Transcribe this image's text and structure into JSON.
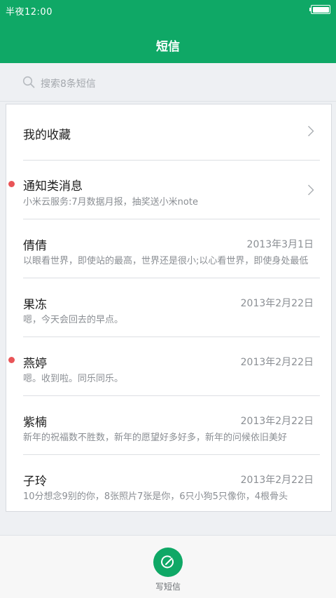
{
  "status": {
    "time": "半夜12:00"
  },
  "header": {
    "title": "短信"
  },
  "search": {
    "placeholder": "搜索8条短信"
  },
  "favorites": {
    "label": "我的收藏"
  },
  "notifications": {
    "title": "通知类消息",
    "preview": "小米云服务:7月数据月报，抽奖送小米note",
    "unread": true
  },
  "conversations": [
    {
      "name": "倩倩",
      "date": "2013年3月1日",
      "preview": "以眼看世界，即使站的最高，世界还是很小;以心看世界，即使身处最低",
      "unread": false
    },
    {
      "name": "果冻",
      "date": "2013年2月22日",
      "preview": "嗯，今天会回去的早点。",
      "unread": false
    },
    {
      "name": "燕婷",
      "date": "2013年2月22日",
      "preview": "嗯。收到啦。同乐同乐。",
      "unread": true
    },
    {
      "name": "紫楠",
      "date": "2013年2月22日",
      "preview": "新年的祝福数不胜数，新年的愿望好多好多，新年的问候依旧美好",
      "unread": false
    },
    {
      "name": "子玲",
      "date": "2013年2月22日",
      "preview": "10分想念9别的你，8张照片7张是你，6只小狗5只像你，4根骨头",
      "unread": false
    }
  ],
  "bottom": {
    "compose_label": "写短信"
  },
  "colors": {
    "accent": "#0fa866",
    "unread": "#e95457"
  }
}
